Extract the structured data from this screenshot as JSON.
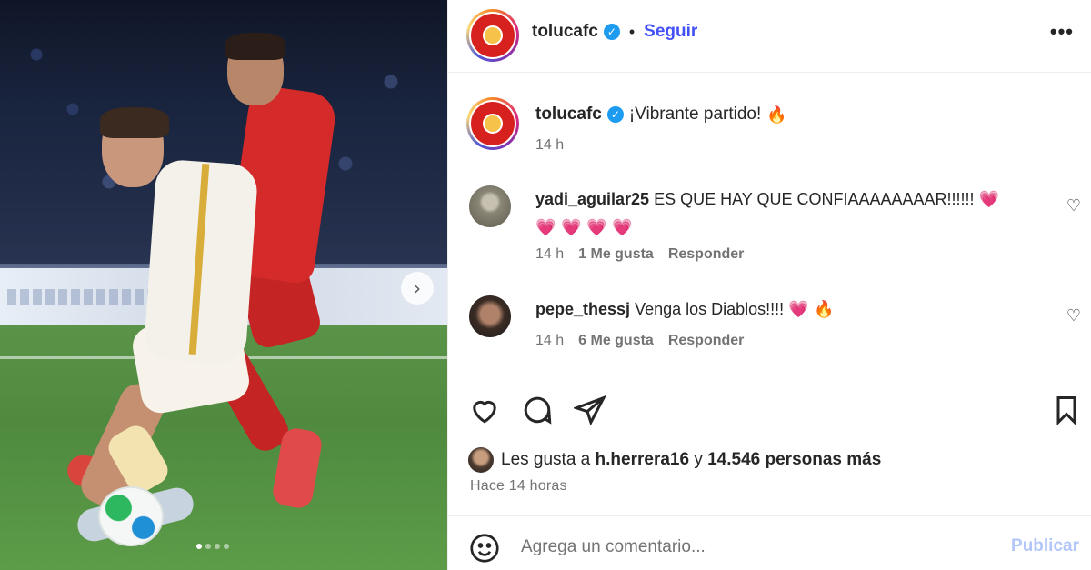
{
  "media": {
    "carousel_next_icon": "chevron-right-icon",
    "dots_total": 4,
    "active_dot": 0
  },
  "header": {
    "username": "tolucafc",
    "separator": "•",
    "follow_label": "Seguir",
    "more_label": "•••"
  },
  "caption": {
    "username": "tolucafc",
    "text": "¡Vibrante partido!",
    "emoji": "🔥",
    "time": "14 h"
  },
  "comments": [
    {
      "username": "yadi_aguilar25",
      "text": "ES QUE HAY QUE CONFIAAAAAAAAR!!!!!!",
      "emoji_line1": "💗",
      "emoji_line2": "💗 💗 💗 💗",
      "time": "14 h",
      "likes": "1 Me gusta",
      "reply": "Responder"
    },
    {
      "username": "pepe_thessj",
      "text": "Venga los Diablos!!!!",
      "emoji_line1": "💗 🔥",
      "time": "14 h",
      "likes": "6 Me gusta",
      "reply": "Responder"
    }
  ],
  "likes": {
    "prefix": "Les gusta a",
    "user": "h.herrera16",
    "connector": "y",
    "count": "14.546 personas más"
  },
  "time_ago": "Hace 14 horas",
  "comment_box": {
    "placeholder": "Agrega un comentario...",
    "publish_label": "Publicar"
  },
  "colors": {
    "follow_blue": "#4150f7",
    "publish_disabled": "#b3c6f9",
    "verified_blue": "#1d9bf0"
  }
}
